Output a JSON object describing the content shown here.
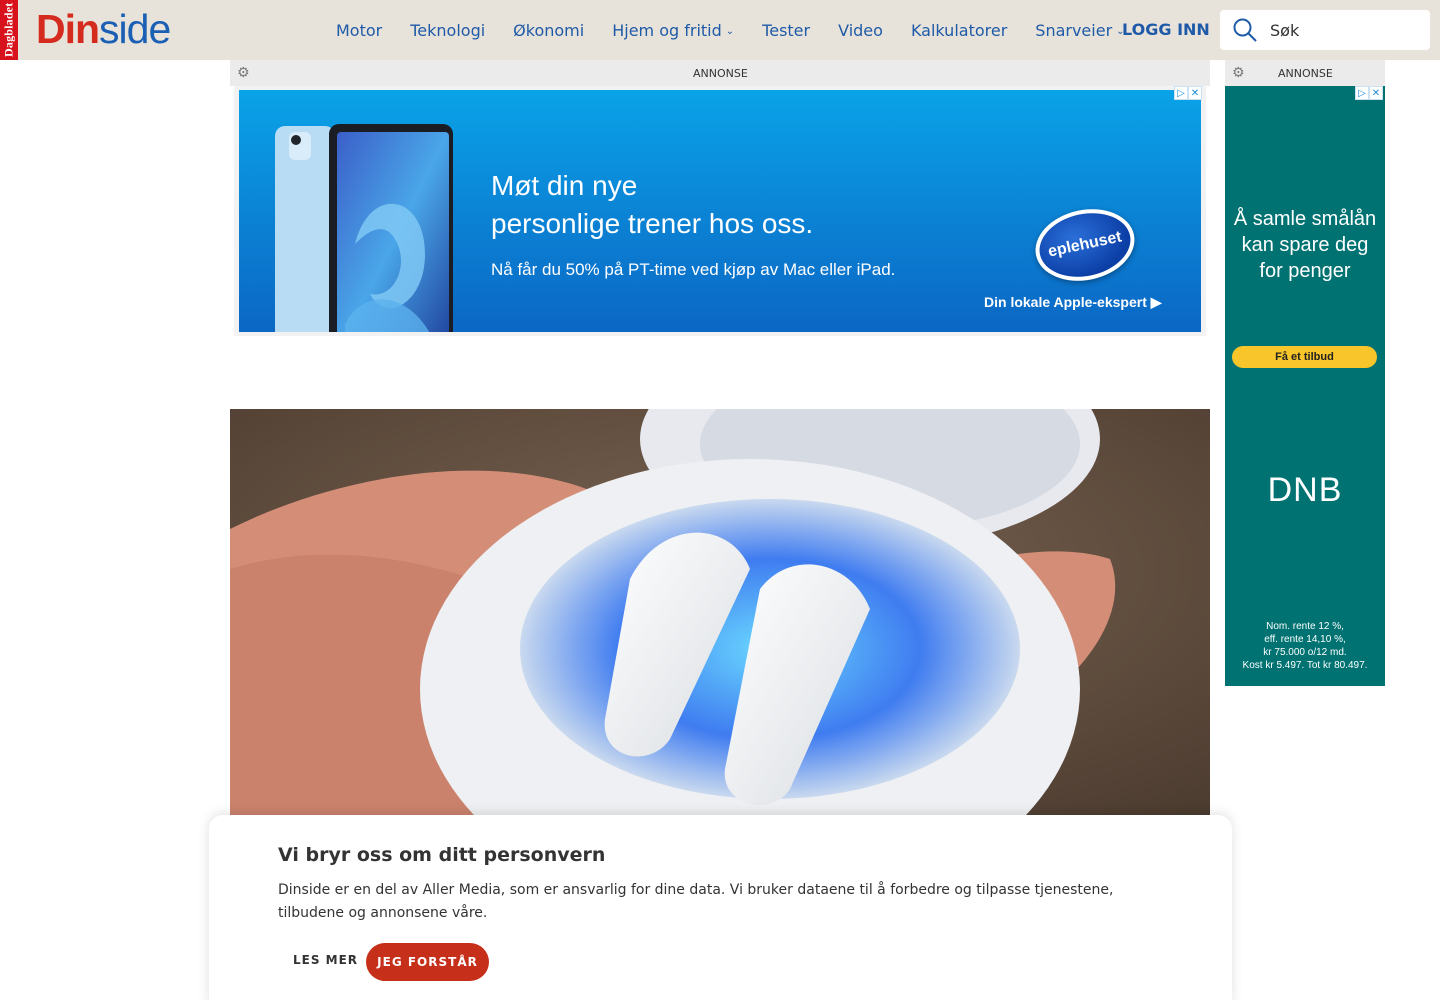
{
  "header": {
    "brand_strip": "Dagbladet",
    "logo_part1": "Din",
    "logo_part2": "side",
    "nav": [
      {
        "label": "Motor",
        "has_dropdown": false
      },
      {
        "label": "Teknologi",
        "has_dropdown": false
      },
      {
        "label": "Økonomi",
        "has_dropdown": false
      },
      {
        "label": "Hjem og fritid",
        "has_dropdown": true
      },
      {
        "label": "Tester",
        "has_dropdown": false
      },
      {
        "label": "Video",
        "has_dropdown": false
      },
      {
        "label": "Kalkulatorer",
        "has_dropdown": false
      },
      {
        "label": "Snarveier",
        "has_dropdown": true
      }
    ],
    "login_label": "LOGG INN",
    "search_placeholder": "Søk",
    "colors": {
      "bar": "#e8e3da",
      "link": "#1e5aa8",
      "logo_red": "#d52b1e",
      "logo_blue": "#1a5fb4"
    }
  },
  "ad_top": {
    "label": "ANNONSE",
    "headline_line1": "Møt din nye",
    "headline_line2": "personlige trener hos oss.",
    "subline": "Nå får du 50% på PT-time ved kjøp av Mac eller iPad.",
    "badge": "eplehuset",
    "cta": "Din lokale Apple-ekspert ▶"
  },
  "ad_side": {
    "label": "ANNONSE",
    "headline": [
      "Å samle smålån",
      "kan spare deg",
      "for penger"
    ],
    "button": "Få et tilbud",
    "brand": "DNB",
    "fine_print": [
      "Nom. rente 12 %,",
      "eff. rente 14,10 %,",
      "kr 75.000 o/12 md.",
      "Kost kr 5.497. Tot kr 80.497."
    ]
  },
  "consent": {
    "title": "Vi bryr oss om ditt personvern",
    "body": "Dinside er en del av Aller Media, som er ansvarlig for dine data. Vi bruker dataene til å forbedre og tilpasse tjenestene, tilbudene og annonsene våre.",
    "more_label": "LES MER",
    "accept_label": "JEG FORSTÅR"
  }
}
